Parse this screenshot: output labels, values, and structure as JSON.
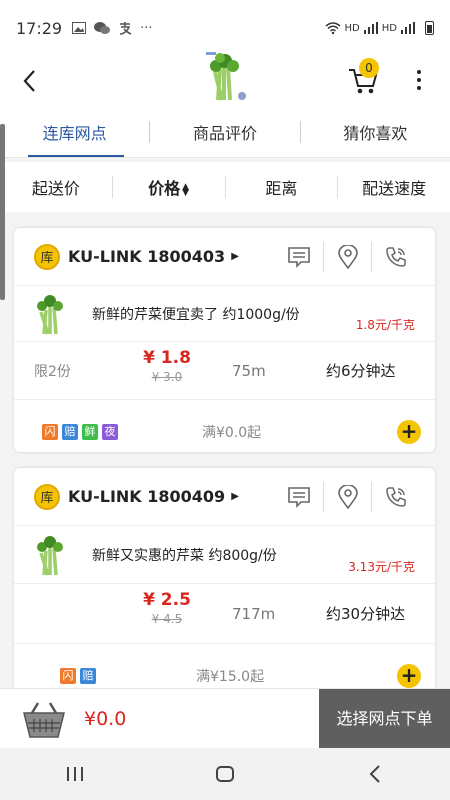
{
  "status_bar": {
    "time": "17:29",
    "right_label_1": "HD",
    "right_label_2": "HD"
  },
  "header": {
    "cart_count": "0"
  },
  "tabs": [
    {
      "label": "连库网点",
      "active": true
    },
    {
      "label": "商品评价",
      "active": false
    },
    {
      "label": "猜你喜欢",
      "active": false
    }
  ],
  "sort": {
    "items": [
      {
        "label": "起送价"
      },
      {
        "label": "价格"
      },
      {
        "label": "距离"
      },
      {
        "label": "配送速度"
      }
    ]
  },
  "stores": [
    {
      "badge": "库",
      "name": "KU-LINK 1800403",
      "product_name": "新鲜的芹菜便宜卖了 约1000g/份",
      "unit_price": "1.8元/千克",
      "limit": "限2份",
      "price": "¥ 1.8",
      "old_price": "¥ 3.0",
      "distance": "75m",
      "eta": "约6分钟达",
      "tags": [
        {
          "text": "闪",
          "color": "#f07a2a"
        },
        {
          "text": "赔",
          "color": "#3a87d8"
        },
        {
          "text": "鲜",
          "color": "#3bbf4a"
        },
        {
          "text": "夜",
          "color": "#8a5ad8"
        }
      ],
      "min_order": "满¥0.0起"
    },
    {
      "badge": "库",
      "name": "KU-LINK 1800409",
      "product_name": "新鲜又实惠的芹菜 约800g/份",
      "unit_price": "3.13元/千克",
      "limit": "",
      "price": "¥ 2.5",
      "old_price": "¥ 4.5",
      "distance": "717m",
      "eta": "约30分钟达",
      "tags": [
        {
          "text": "闪",
          "color": "#f07a2a"
        },
        {
          "text": "赔",
          "color": "#3a87d8"
        }
      ],
      "min_order": "满¥15.0起"
    }
  ],
  "bottom": {
    "total": "¥0.0",
    "checkout_label": "选择网点下单"
  }
}
